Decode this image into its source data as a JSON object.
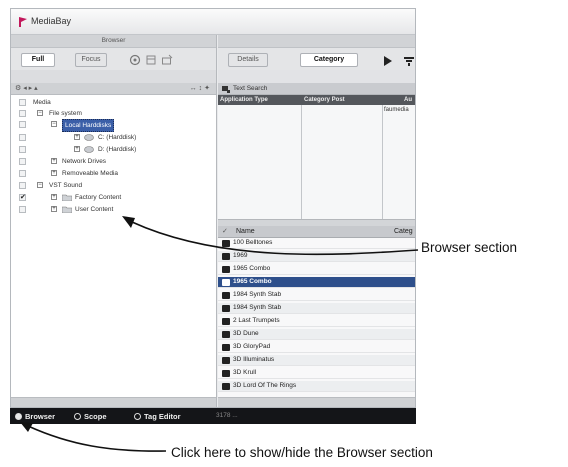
{
  "window": {
    "title": "MediaBay",
    "browser_header": "Browser",
    "browser_tabs": [
      "Full",
      "Focus"
    ],
    "right_tabs": [
      "Details",
      "Category"
    ]
  },
  "tree": {
    "toolbar_left": "⚙  ◂ ▸ ▴",
    "toolbar_right": "↔ ↕ ✦",
    "items": [
      {
        "label": "Media",
        "checked": false
      },
      {
        "label": "File system",
        "checked": false
      },
      {
        "label": "Local Harddisks",
        "checked": false,
        "selected": true
      },
      {
        "label": "C: (Harddisk)",
        "checked": false
      },
      {
        "label": "D: (Harddisk)",
        "checked": false
      },
      {
        "label": "Network Drives",
        "checked": false
      },
      {
        "label": "Removeable Media",
        "checked": false
      },
      {
        "label": "VST Sound",
        "checked": false
      },
      {
        "label": "Factory Content",
        "checked": true
      },
      {
        "label": "User Content",
        "checked": false
      }
    ]
  },
  "search": {
    "label": "Text Search"
  },
  "filter": {
    "columns": [
      "Application Type",
      "Category Post",
      "Au"
    ],
    "value": "faumedia"
  },
  "results": {
    "columns": [
      "Name",
      "Categ"
    ],
    "items": [
      "100 Belltones",
      "1969",
      "1965 Combo",
      "1965 Combo",
      "1984 Synth Stab",
      "1984 Synth Stab",
      "2 Last Trumpets",
      "3D Dune",
      "3D GloryPad",
      "3D Illuminatus",
      "3D Krull",
      "3D Lord Of The Rings"
    ],
    "selected_index": 3
  },
  "statusbar": {
    "items": [
      {
        "label": "Browser",
        "on": true
      },
      {
        "label": "Scope",
        "on": false
      },
      {
        "label": "Tag Editor",
        "on": false
      }
    ],
    "extra": "3178 ..."
  },
  "callouts": {
    "browser_section": "Browser section",
    "toggle": "Click here to show/hide the Browser section"
  },
  "colors": {
    "selection": "#2e4f8b",
    "statusbar": "#141518"
  }
}
